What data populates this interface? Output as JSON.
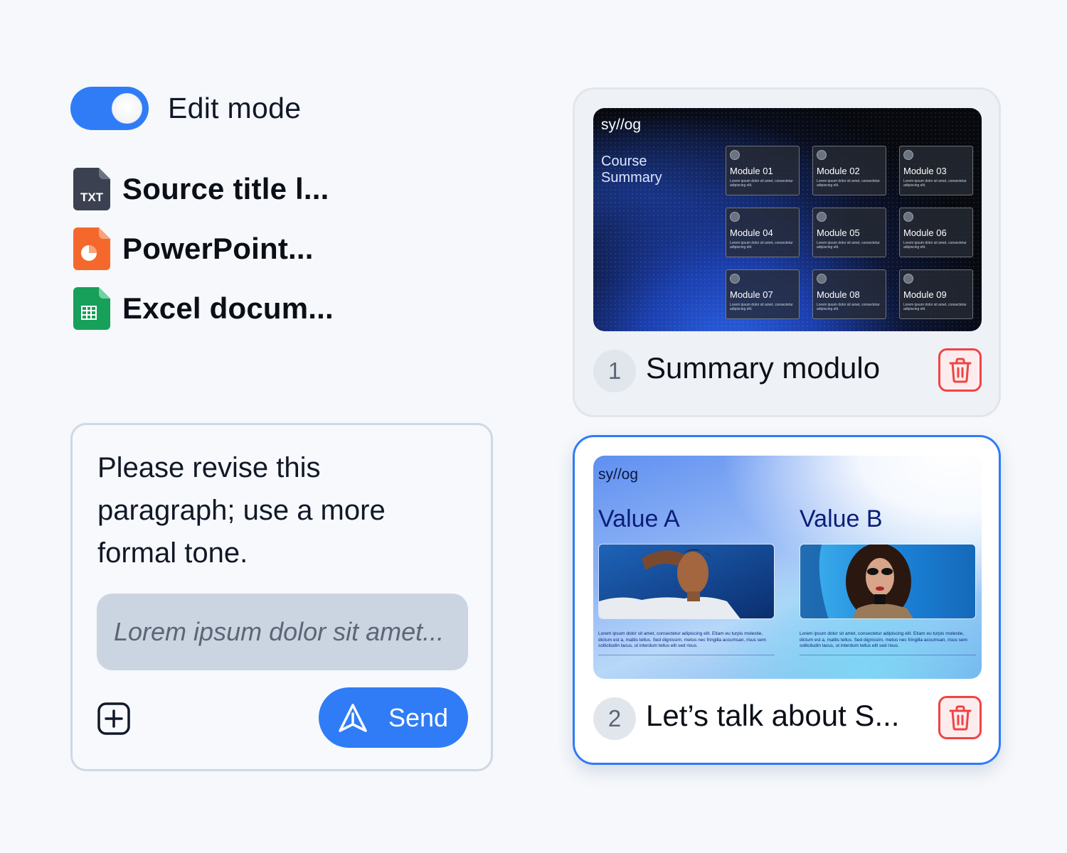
{
  "edit_mode": {
    "label": "Edit mode",
    "enabled": true,
    "accent": "#2f7cf6"
  },
  "sources": [
    {
      "type_icon": "txt-file-icon",
      "badge": "TXT",
      "name": "Source title l...",
      "color": "#3b4150"
    },
    {
      "type_icon": "powerpoint-file-icon",
      "name": "PowerPoint...",
      "color": "#f4682c"
    },
    {
      "type_icon": "excel-file-icon",
      "name": "Excel docum...",
      "color": "#16a05a"
    }
  ],
  "prompt": {
    "text": "Please revise this paragraph; use a more formal tone.",
    "placeholder": "Lorem ipsum dolor sit amet...",
    "send_label": "Send"
  },
  "slides": [
    {
      "number": "1",
      "title": "Summary modulo",
      "thumbnail": {
        "logo": "sy//og",
        "heading": "Course Summary",
        "modules": [
          {
            "title": "Module 01",
            "desc": "Lorem ipsum dolor sit amet, consectetur adipiscing elit."
          },
          {
            "title": "Module 02",
            "desc": "Lorem ipsum dolor sit amet, consectetur adipiscing elit."
          },
          {
            "title": "Module 03",
            "desc": "Lorem ipsum dolor sit amet, consectetur adipiscing elit."
          },
          {
            "title": "Module 04",
            "desc": "Lorem ipsum dolor sit amet, consectetur adipiscing elit."
          },
          {
            "title": "Module 05",
            "desc": "Lorem ipsum dolor sit amet, consectetur adipiscing elit."
          },
          {
            "title": "Module 06",
            "desc": "Lorem ipsum dolor sit amet, consectetur adipiscing elit."
          },
          {
            "title": "Module 07",
            "desc": "Lorem ipsum dolor sit amet, consectetur adipiscing elit."
          },
          {
            "title": "Module 08",
            "desc": "Lorem ipsum dolor sit amet, consectetur adipiscing elit."
          },
          {
            "title": "Module 09",
            "desc": "Lorem ipsum dolor sit amet, consectetur adipiscing elit."
          }
        ]
      }
    },
    {
      "number": "2",
      "title": "Let’s talk about S...",
      "selected": true,
      "thumbnail": {
        "logo": "sy//og",
        "values": [
          {
            "title": "Value A",
            "text": "Lorem ipsum dolor sit amet, consectetur adipiscing elit. Etiam eu turpis molestie, dictum est a, mattis tellus. Sed dignissim, metus nec fringilla accumsan, risus sem sollicitudin lacus, ut interdum tellus elit sed risus."
          },
          {
            "title": "Value B",
            "text": "Lorem ipsum dolor sit amet, consectetur adipiscing elit. Etiam eu turpis molestie, dictum est a, mattis tellus. Sed dignissim, metus nec fringilla accumsan, risus sem sollicitudin lacus, ut interdum tellus elit sed risus."
          }
        ]
      }
    }
  ],
  "colors": {
    "accent": "#2f7cf6",
    "danger": "#ef4444",
    "background": "#f6f8fb"
  }
}
